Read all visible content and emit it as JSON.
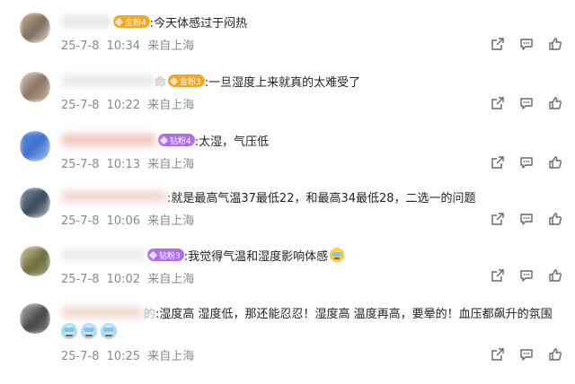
{
  "comments": [
    {
      "badge": "金粉4",
      "badge_color": "#f5a623",
      "text": ":今天体感过于闷热",
      "date": "25-7-8",
      "time": "10:34",
      "location": "来自上海"
    },
    {
      "name_fragment": "命",
      "badge": "金粉3",
      "badge_color": "#f5a623",
      "text": ":一旦湿度上来就真的太难受了",
      "date": "25-7-8",
      "time": "10:22",
      "location": "来自上海"
    },
    {
      "badge": "钻粉4",
      "badge_color": "#b06cf0",
      "text": ":太湿，气压低",
      "date": "25-7-8",
      "time": "10:13",
      "location": "来自上海"
    },
    {
      "text": ":就是最高气温37最低22，和最高34最低28，二选一的问题",
      "date": "25-7-8",
      "time": "10:06",
      "location": "来自上海"
    },
    {
      "badge": "钻粉3",
      "badge_color": "#b06cf0",
      "text": ":我觉得气温和湿度影响体感",
      "date": "25-7-8",
      "time": "10:02",
      "location": "来自上海"
    },
    {
      "name_fragment": "的",
      "text": ":湿度高 湿度低，那还能忍忍！湿度高 温度再高，要晕的！血压都飙升的氛围",
      "date": "25-7-8",
      "time": "10:25",
      "location": "来自上海"
    }
  ],
  "icons": {
    "share": "share-icon",
    "comment": "comment-icon",
    "like": "thumbs-up-icon",
    "emoji_cold": "cold-face-emoji-icon"
  }
}
